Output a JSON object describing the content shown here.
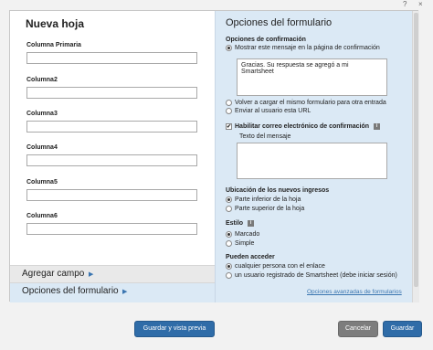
{
  "window": {
    "help": "?",
    "close": "×"
  },
  "left": {
    "sheet_title": "Nueva hoja",
    "columns": [
      {
        "label": "Columna Primaria",
        "value": ""
      },
      {
        "label": "Columna2",
        "value": ""
      },
      {
        "label": "Columna3",
        "value": ""
      },
      {
        "label": "Columna4",
        "value": ""
      },
      {
        "label": "Columna5",
        "value": ""
      },
      {
        "label": "Columna6",
        "value": ""
      }
    ],
    "agregar_label": "Agregar campo",
    "opciones_label": "Opciones del formulario"
  },
  "right": {
    "title": "Opciones del formulario",
    "confirm_heading": "Opciones de confirmación",
    "confirm_show_msg": "Mostrar este mensaje en la página de confirmación",
    "confirm_msg_value": "Gracias. Su respuesta se agregó a mi Smartsheet",
    "confirm_reload": "Volver a cargar el mismo formulario para otra entrada",
    "confirm_url": "Enviar al usuario esta URL",
    "email_confirm": "Habilitar correo electrónico de confirmación",
    "msg_text_label": "Texto del mensaje",
    "location_heading": "Ubicación de los nuevos ingresos",
    "location_bottom": "Parte inferior de la hoja",
    "location_top": "Parte superior de la hoja",
    "style_heading": "Estilo",
    "style_marked": "Marcado",
    "style_simple": "Simple",
    "access_heading": "Pueden acceder",
    "access_anyone": "cualquier persona con el enlace",
    "access_registered": "un usuario registrado de Smartsheet (debe iniciar sesión)",
    "advanced_link": "Opciones avanzadas de formularios"
  },
  "footer": {
    "preview_label": "Guardar y vista previa",
    "cancel_label": "Cancelar",
    "save_label": "Guardar"
  },
  "colors": {
    "accent": "#2f6ca8",
    "panel_bg": "#dbe9f5",
    "link": "#3a75b0"
  }
}
